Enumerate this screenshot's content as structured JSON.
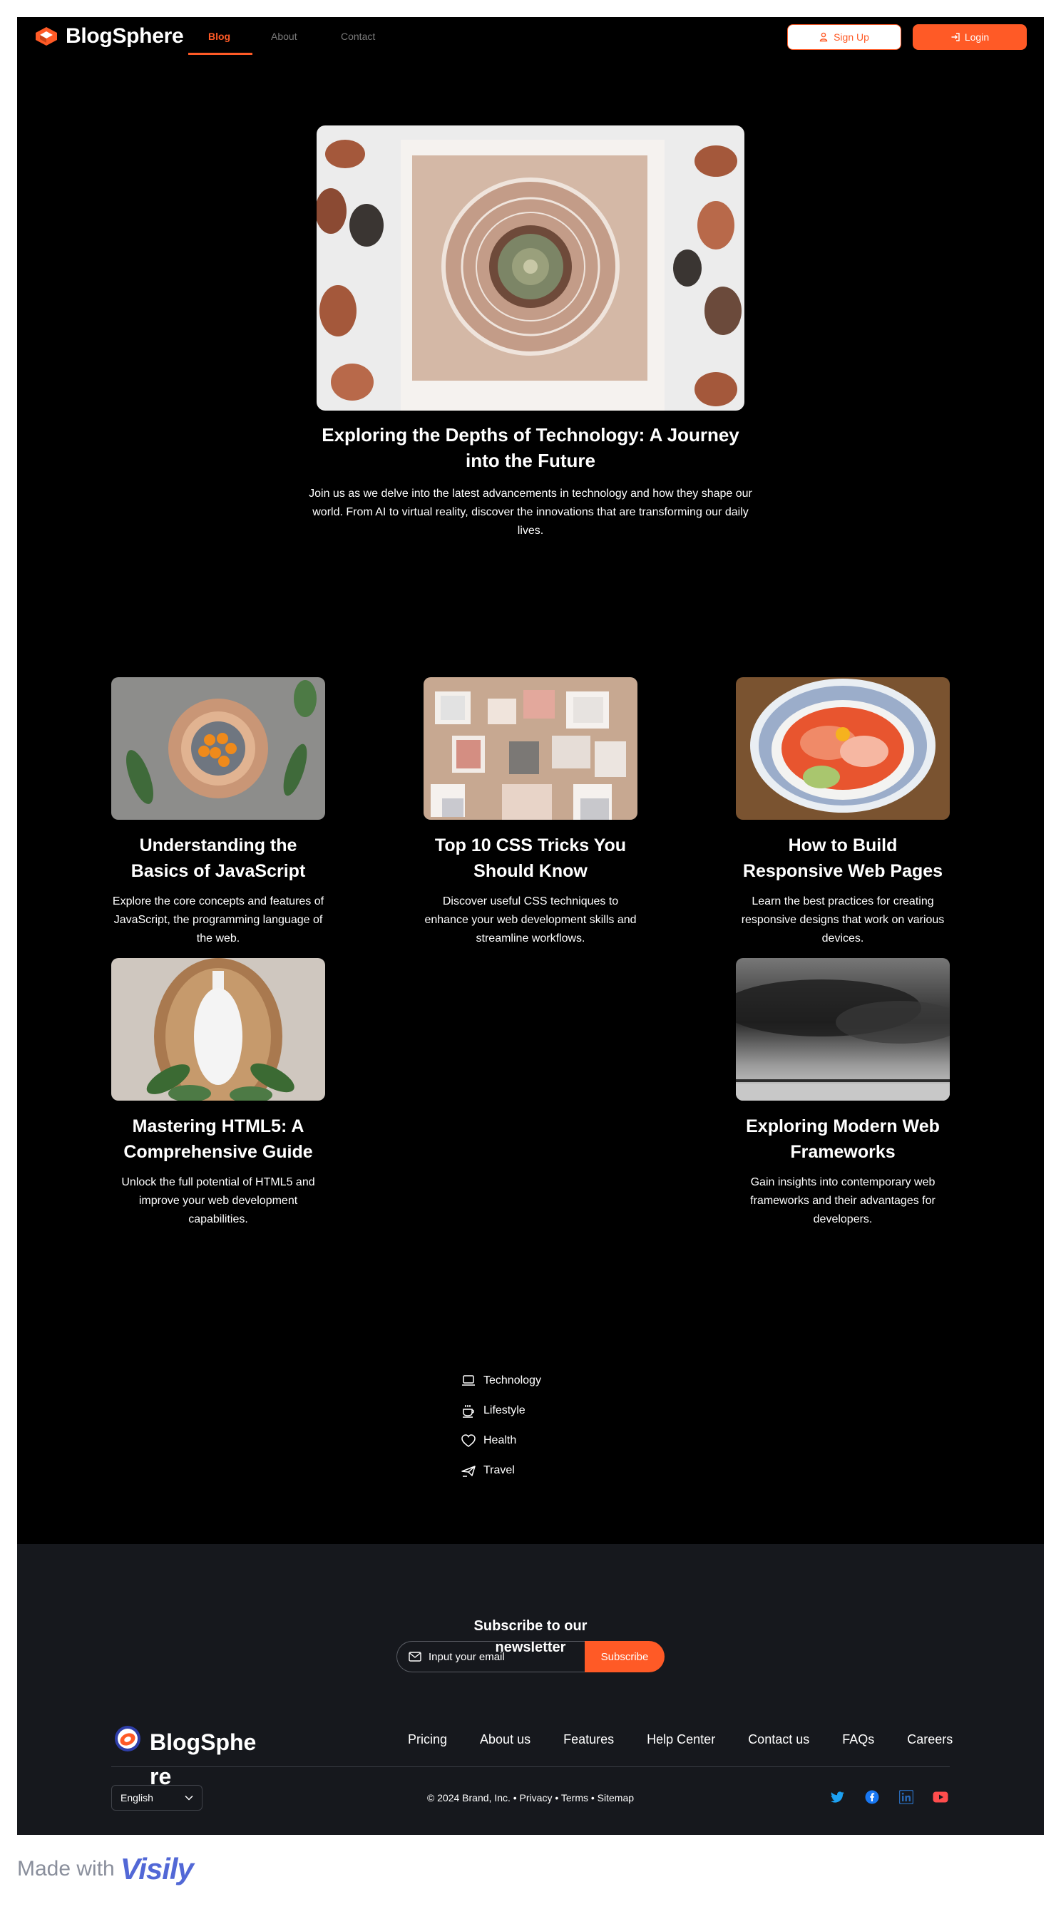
{
  "brand": {
    "name": "BlogSphere",
    "accent_color": "#ff5a26"
  },
  "nav": {
    "links": [
      "Blog",
      "About",
      "Contact"
    ],
    "active": "Blog",
    "signup_label": "Sign Up",
    "login_label": "Login",
    "signup_icon": "user-plus-icon",
    "login_icon": "login-icon"
  },
  "hero": {
    "title": "Exploring the Depths of Technology: A Journey into the Future",
    "description": "Join us as we delve into the latest advancements in technology and how they shape our world. From AI to virtual reality, discover the innovations that are transforming our daily lives."
  },
  "cards": [
    {
      "title": "Understanding the Basics of JavaScript",
      "description": "Explore the core concepts and features of JavaScript, the programming language of the web."
    },
    {
      "title": "Top 10 CSS Tricks You Should Know",
      "description": "Discover useful CSS techniques to enhance your web development skills and streamline workflows."
    },
    {
      "title": "How to Build Responsive Web Pages",
      "description": "Learn the best practices for creating responsive designs that work on various devices."
    },
    {
      "title": "Mastering HTML5: A Comprehensive Guide",
      "description": "Unlock the full potential of HTML5 and improve your web development capabilities."
    },
    {
      "title": "Exploring Modern Web Frameworks",
      "description": "Gain insights into contemporary web frameworks and their advantages for developers."
    }
  ],
  "categories": [
    {
      "label": "Technology",
      "icon": "laptop-icon"
    },
    {
      "label": "Lifestyle",
      "icon": "coffee-icon"
    },
    {
      "label": "Health",
      "icon": "heart-icon"
    },
    {
      "label": "Travel",
      "icon": "plane-icon"
    }
  ],
  "newsletter": {
    "title": "Subscribe to our newsletter",
    "placeholder": "Input your email",
    "button_label": "Subscribe",
    "input_icon": "mail-icon"
  },
  "footer": {
    "brand": "BlogSphere",
    "links": [
      "Pricing",
      "About us",
      "Features",
      "Help Center",
      "Contact us",
      "FAQs",
      "Careers"
    ],
    "language": "English",
    "copyright": "© 2024 Brand, Inc. • Privacy • Terms • Sitemap",
    "socials": [
      {
        "name": "twitter-icon",
        "color": "#1da1f2"
      },
      {
        "name": "facebook-icon",
        "color": "#1877f2"
      },
      {
        "name": "linkedin-icon",
        "color": "#2867b2"
      },
      {
        "name": "youtube-icon",
        "color": "#ff4d4d"
      }
    ]
  },
  "made_with": {
    "text": "Made with",
    "brand": "Visily"
  }
}
